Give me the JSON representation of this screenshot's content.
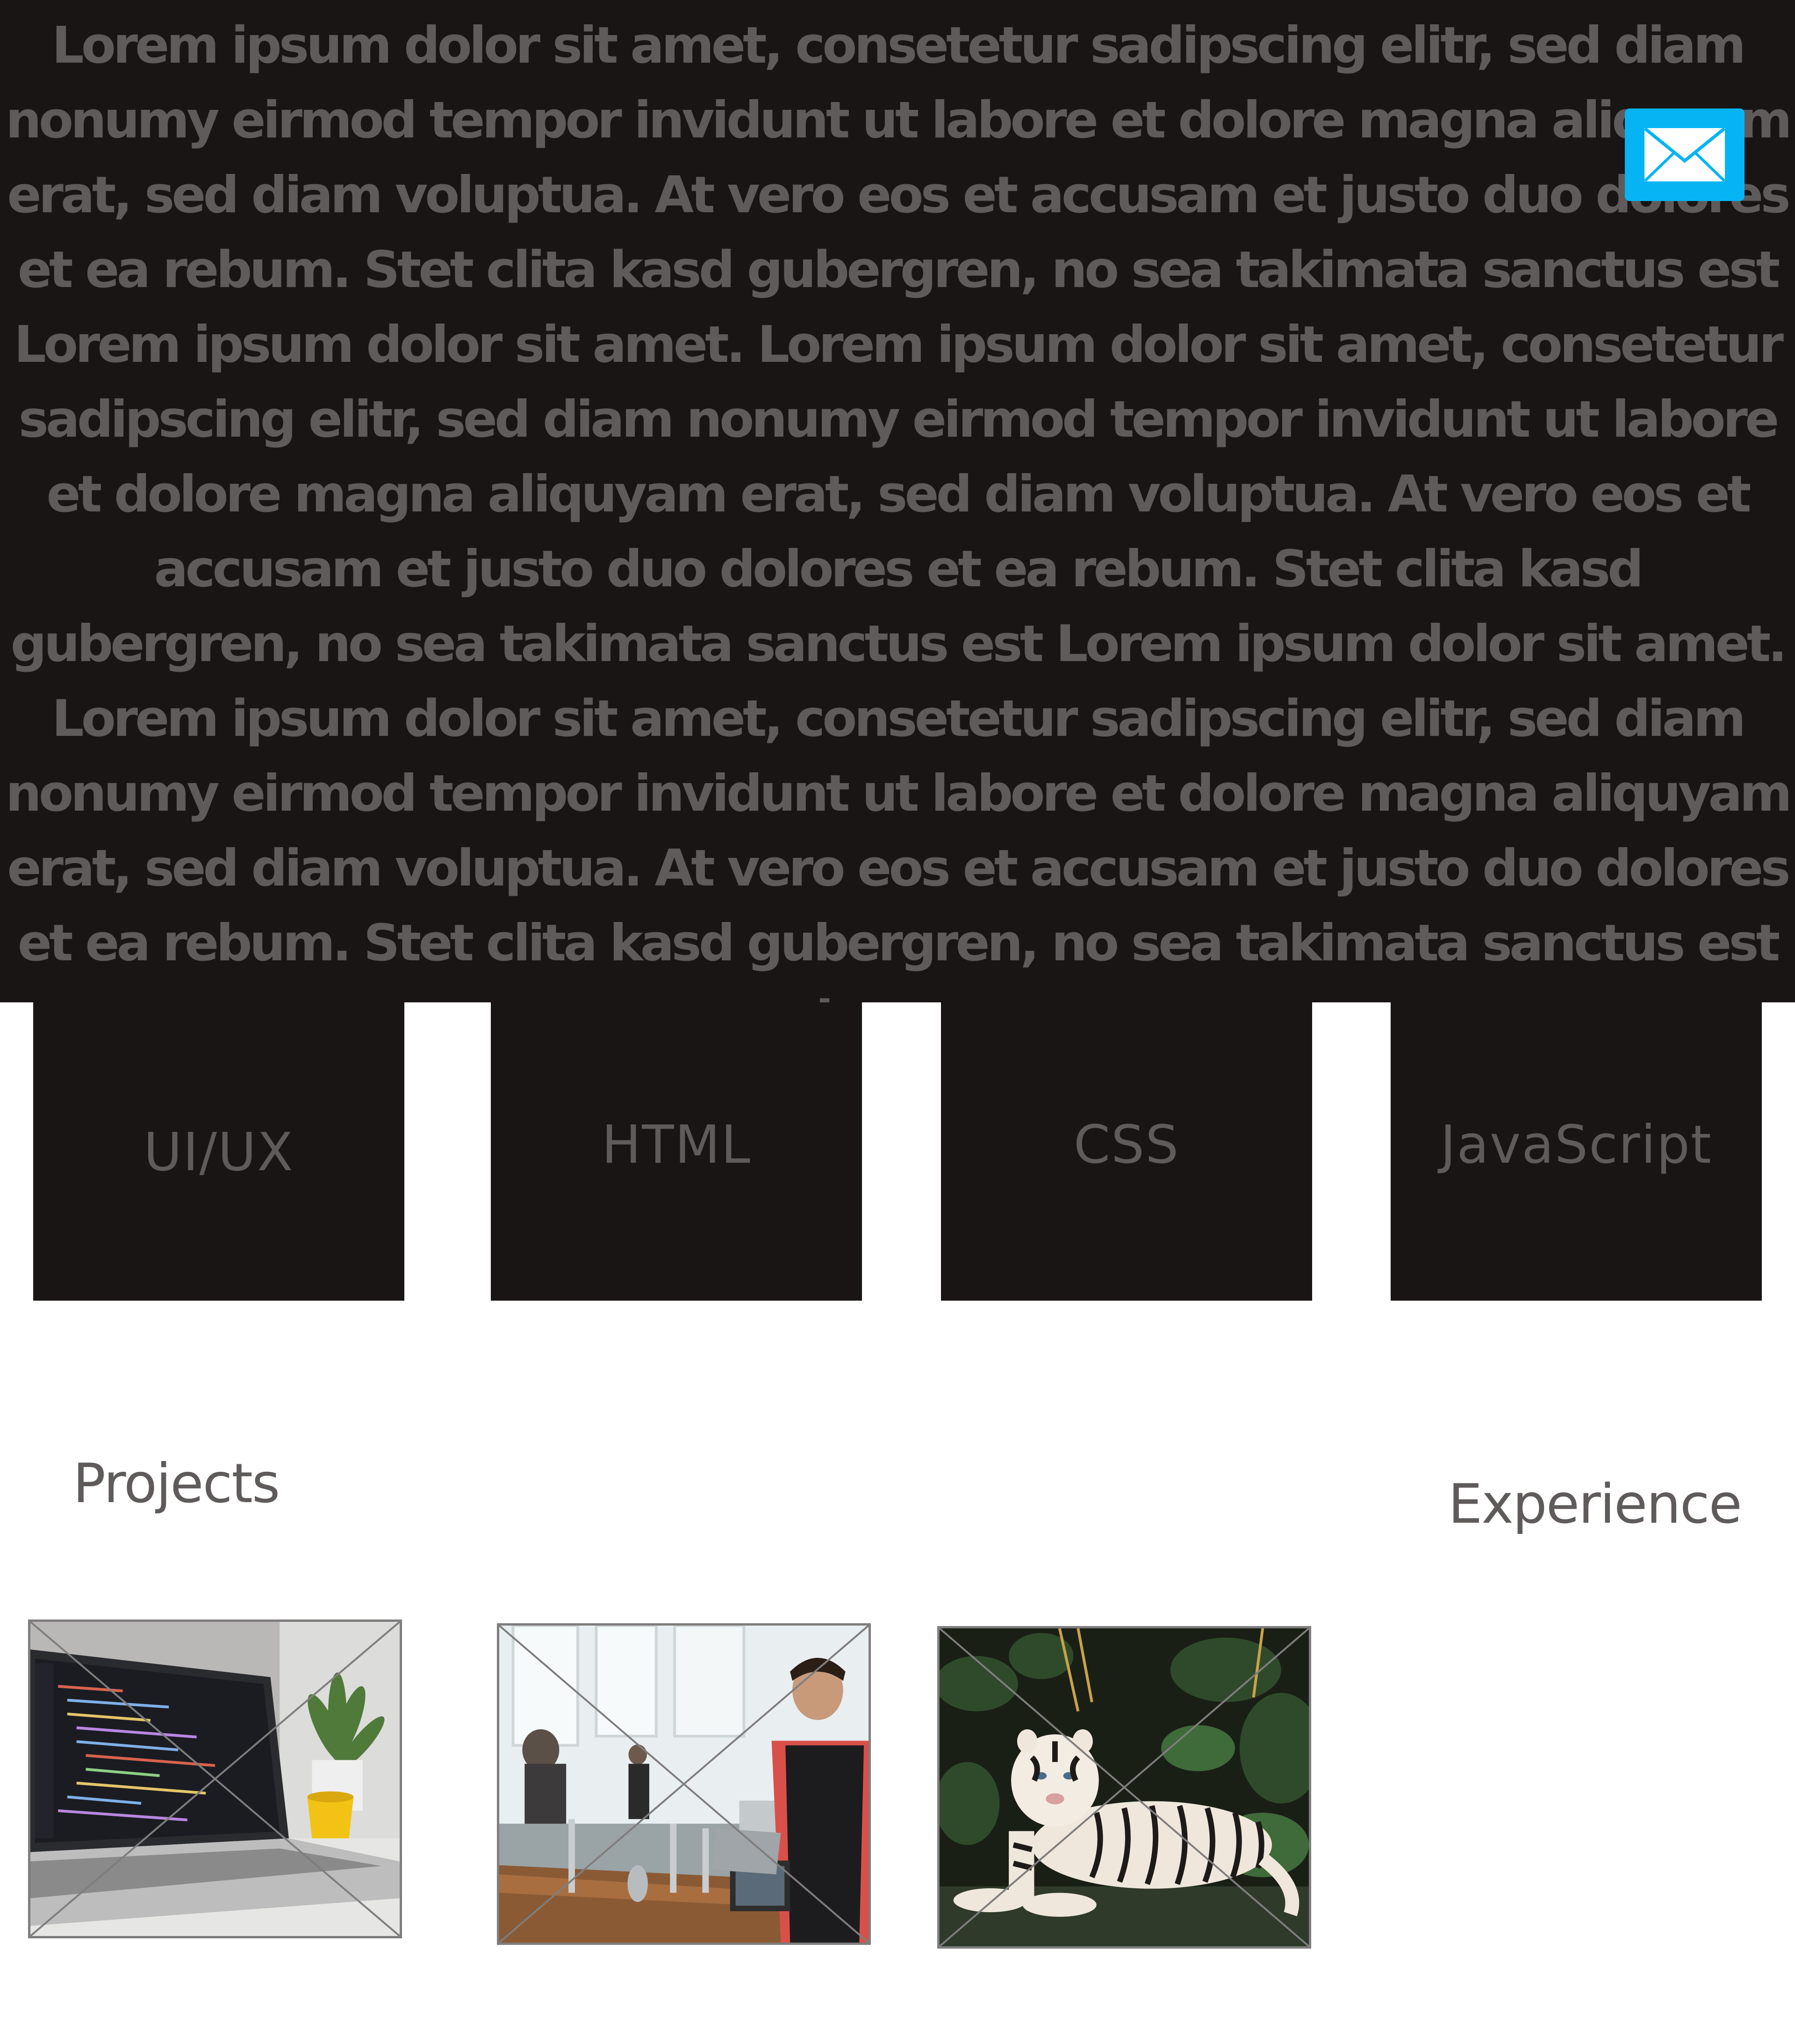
{
  "hero": {
    "paragraphs": [
      "Lorem ipsum dolor sit amet, consetetur sadipscing elitr, sed diam nonumy eirmod tempor invidunt ut labore et dolore magna aliquyam erat, sed diam voluptua. At vero eos et accusam et justo duo dolores et ea rebum. Stet clita kasd gubergren, no sea takimata sanctus est Lorem ipsum dolor sit amet. Lorem ipsum dolor sit amet, consetetur sadipscing elitr, sed diam nonumy eirmod tempor invidunt ut labore et dolore magna aliquyam erat, sed diam voluptua. At vero eos et accusam et justo duo dolores et ea rebum. Stet clita kasd gubergren, no sea takimata sanctus est Lorem ipsum dolor sit amet.",
      "Lorem ipsum dolor sit amet, consetetur sadipscing elitr, sed diam nonumy eirmod tempor invidunt ut labore et dolore magna aliquyam erat, sed diam voluptua. At vero eos et accusam et justo duo dolores et ea rebum. Stet clita kasd gubergren, no sea takimata sanctus est Lorem"
    ]
  },
  "contact": {
    "icon": "mail-icon",
    "color": "#06b4f4"
  },
  "skills": [
    {
      "label": "UI/UX"
    },
    {
      "label": "HTML"
    },
    {
      "label": "CSS"
    },
    {
      "label": "JavaScript"
    }
  ],
  "sections": {
    "projects": "Projects",
    "experience": "Experience"
  },
  "projects": [
    {
      "image": "laptop-code-photo"
    },
    {
      "image": "cafe-barista-photo"
    },
    {
      "image": "white-tiger-photo"
    }
  ],
  "colors": {
    "dark_panel": "#181514",
    "muted_text": "#5e5b5a",
    "accent": "#06b4f4",
    "placeholder_border": "#7f7d7d"
  }
}
